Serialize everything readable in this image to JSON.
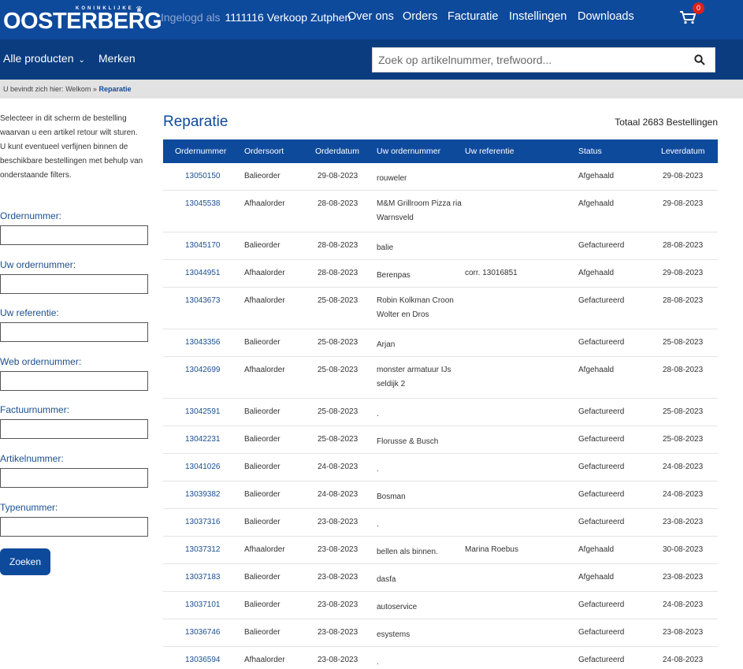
{
  "header": {
    "logo_small": "KONINKLIJKE",
    "logo_text": "OOSTERBERG",
    "logged_in_label": "Ingelogd als",
    "user": "1111116 Verkoop Zutphen",
    "nav": [
      "Over ons",
      "Orders",
      "Facturatie",
      "Instellingen",
      "Downloads"
    ],
    "cart_count": "0"
  },
  "navbar": {
    "products": "Alle producten",
    "brands": "Merken",
    "search_placeholder": "Zoek op artikelnummer, trefwoord..."
  },
  "breadcrumb": {
    "prefix": "U bevindt zich hier:",
    "home": "Welkom",
    "sep": "»",
    "current": "Reparatie"
  },
  "sidebar": {
    "intro_1": "Selecteer in dit scherm de bestelling waarvan u een artikel retour wilt sturen.",
    "intro_2": "U kunt eventueel verfijnen binnen de beschikbare bestellingen met behulp van onderstaande filters.",
    "filters": [
      "Ordernummer:",
      "Uw ordernummer:",
      "Uw referentie:",
      "Web ordernummer:",
      "Factuurnummer:",
      "Artikelnummer:",
      "Typenummer:"
    ],
    "button": "Zoeken"
  },
  "main": {
    "title": "Reparatie",
    "total": "Totaal 2683 Bestellingen",
    "columns": [
      "Ordernummer",
      "Ordersoort",
      "Orderdatum",
      "Uw ordernummer",
      "Uw referentie",
      "Status",
      "Leverdatum"
    ],
    "rows": [
      {
        "nr": "13050150",
        "soort": "Balieorder",
        "datum": "29-08-2023",
        "uw": "rouweler",
        "ref": "",
        "status": "Afgehaald",
        "lever": "29-08-2023"
      },
      {
        "nr": "13045538",
        "soort": "Afhaalorder",
        "datum": "28-08-2023",
        "uw": "M&M Grillroom Pizza ria Warnsveld",
        "ref": "",
        "status": "Afgehaald",
        "lever": "29-08-2023"
      },
      {
        "nr": "13045170",
        "soort": "Balieorder",
        "datum": "28-08-2023",
        "uw": "balie",
        "ref": "",
        "status": "Gefactureerd",
        "lever": "28-08-2023"
      },
      {
        "nr": "13044951",
        "soort": "Afhaalorder",
        "datum": "28-08-2023",
        "uw": "Berenpas",
        "ref": "corr. 13016851",
        "status": "Afgehaald",
        "lever": "29-08-2023"
      },
      {
        "nr": "13043673",
        "soort": "Afhaalorder",
        "datum": "25-08-2023",
        "uw": "Robin Kolkman Croon Wolter en Dros",
        "ref": "",
        "status": "Gefactureerd",
        "lever": "28-08-2023"
      },
      {
        "nr": "13043356",
        "soort": "Balieorder",
        "datum": "25-08-2023",
        "uw": "Arjan",
        "ref": "",
        "status": "Gefactureerd",
        "lever": "25-08-2023"
      },
      {
        "nr": "13042699",
        "soort": "Afhaalorder",
        "datum": "25-08-2023",
        "uw": "monster armatuur IJs seldijk 2",
        "ref": "",
        "status": "Afgehaald",
        "lever": "28-08-2023"
      },
      {
        "nr": "13042591",
        "soort": "Balieorder",
        "datum": "25-08-2023",
        "uw": ".",
        "ref": "",
        "status": "Gefactureerd",
        "lever": "25-08-2023"
      },
      {
        "nr": "13042231",
        "soort": "Balieorder",
        "datum": "25-08-2023",
        "uw": "Florusse & Busch",
        "ref": "",
        "status": "Gefactureerd",
        "lever": "25-08-2023"
      },
      {
        "nr": "13041026",
        "soort": "Balieorder",
        "datum": "24-08-2023",
        "uw": ".",
        "ref": "",
        "status": "Gefactureerd",
        "lever": "24-08-2023"
      },
      {
        "nr": "13039382",
        "soort": "Balieorder",
        "datum": "24-08-2023",
        "uw": "Bosman",
        "ref": "",
        "status": "Gefactureerd",
        "lever": "24-08-2023"
      },
      {
        "nr": "13037316",
        "soort": "Balieorder",
        "datum": "23-08-2023",
        "uw": ".",
        "ref": "",
        "status": "Gefactureerd",
        "lever": "23-08-2023"
      },
      {
        "nr": "13037312",
        "soort": "Afhaalorder",
        "datum": "23-08-2023",
        "uw": "bellen als binnen.",
        "ref": "Marina Roebus",
        "status": "Afgehaald",
        "lever": "30-08-2023"
      },
      {
        "nr": "13037183",
        "soort": "Balieorder",
        "datum": "23-08-2023",
        "uw": "dasfa",
        "ref": "",
        "status": "Afgehaald",
        "lever": "23-08-2023"
      },
      {
        "nr": "13037101",
        "soort": "Balieorder",
        "datum": "23-08-2023",
        "uw": "autoservice",
        "ref": "",
        "status": "Gefactureerd",
        "lever": "24-08-2023"
      },
      {
        "nr": "13036746",
        "soort": "Balieorder",
        "datum": "23-08-2023",
        "uw": "esystems",
        "ref": "",
        "status": "Gefactureerd",
        "lever": "23-08-2023"
      },
      {
        "nr": "13036594",
        "soort": "Afhaalorder",
        "datum": "23-08-2023",
        "uw": ".",
        "ref": "",
        "status": "Gefactureerd",
        "lever": "24-08-2023"
      }
    ]
  }
}
